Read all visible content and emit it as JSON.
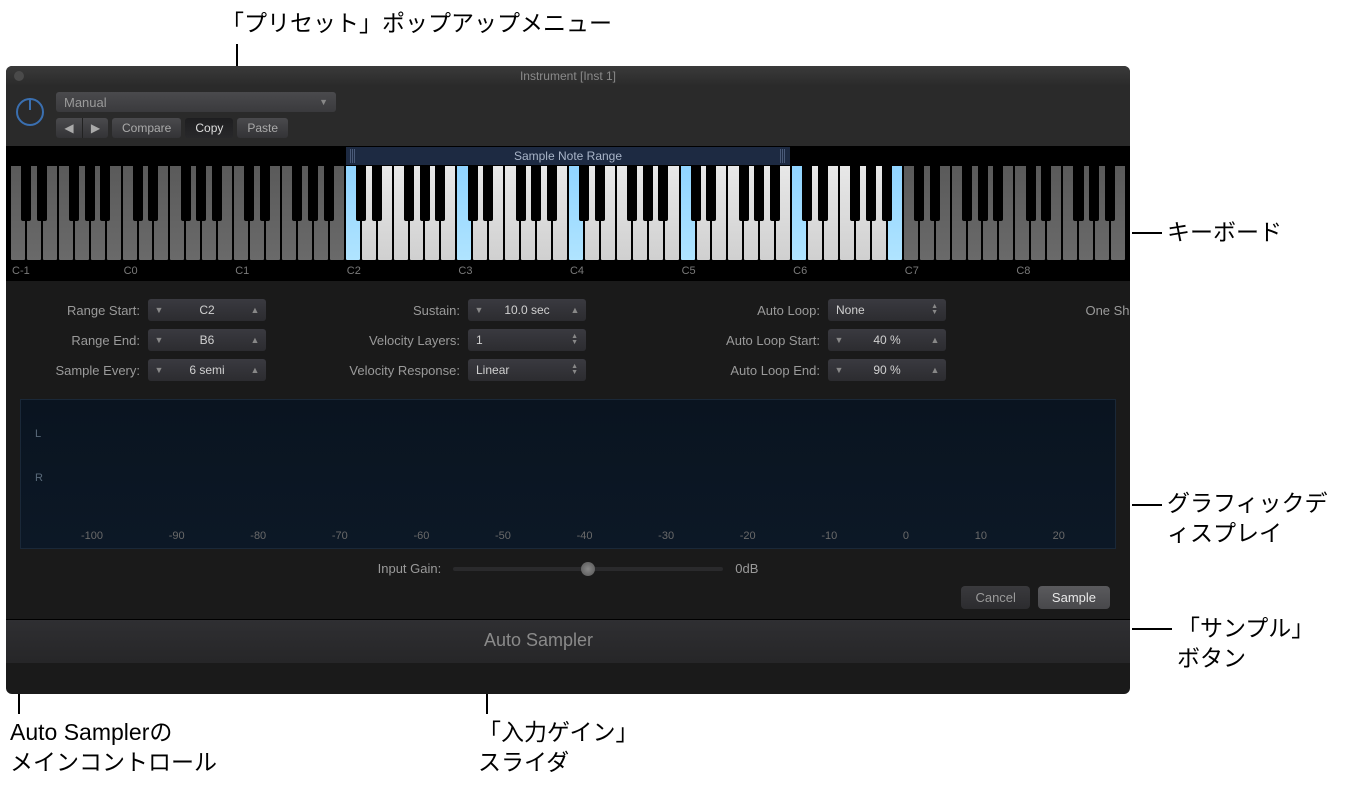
{
  "annotations": {
    "preset_menu": "「プリセット」ポップアップメニュー",
    "keyboard": "キーボード",
    "graphic_display_l1": "グラフィックデ",
    "graphic_display_l2": "ィスプレイ",
    "sample_button_l1": "「サンプル」",
    "sample_button_l2": "ボタン",
    "main_controls_l1": "Auto Samplerの",
    "main_controls_l2": "メインコントロール",
    "input_gain_l1": "「入力ゲイン」",
    "input_gain_l2": "スライダ"
  },
  "window": {
    "title": "Instrument [Inst 1]"
  },
  "toolbar": {
    "preset": "Manual",
    "compare": "Compare",
    "copy": "Copy",
    "paste": "Paste"
  },
  "keyboard": {
    "range_header": "Sample Note Range",
    "octaves": [
      "C-1",
      "C0",
      "C1",
      "C2",
      "C3",
      "C4",
      "C5",
      "C6",
      "C7",
      "C8"
    ]
  },
  "controls": {
    "range_start": {
      "label": "Range Start:",
      "value": "C2"
    },
    "range_end": {
      "label": "Range End:",
      "value": "B6"
    },
    "sample_every": {
      "label": "Sample Every:",
      "value": "6 semi"
    },
    "sustain": {
      "label": "Sustain:",
      "value": "10.0 sec"
    },
    "vel_layers": {
      "label": "Velocity Layers:",
      "value": "1"
    },
    "vel_response": {
      "label": "Velocity Response:",
      "value": "Linear"
    },
    "auto_loop": {
      "label": "Auto Loop:",
      "value": "None"
    },
    "auto_loop_start": {
      "label": "Auto Loop Start:",
      "value": "40 %"
    },
    "auto_loop_end": {
      "label": "Auto Loop End:",
      "value": "90 %"
    },
    "one_shot": {
      "label": "One Shot:"
    }
  },
  "waveform": {
    "left_label": "L",
    "right_label": "R",
    "ticks": [
      "-100",
      "-90",
      "-80",
      "-70",
      "-60",
      "-50",
      "-40",
      "-30",
      "-20",
      "-10",
      "0",
      "10",
      "20"
    ]
  },
  "gain": {
    "label": "Input Gain:",
    "value": "0dB"
  },
  "actions": {
    "cancel": "Cancel",
    "sample": "Sample"
  },
  "footer": "Auto Sampler"
}
